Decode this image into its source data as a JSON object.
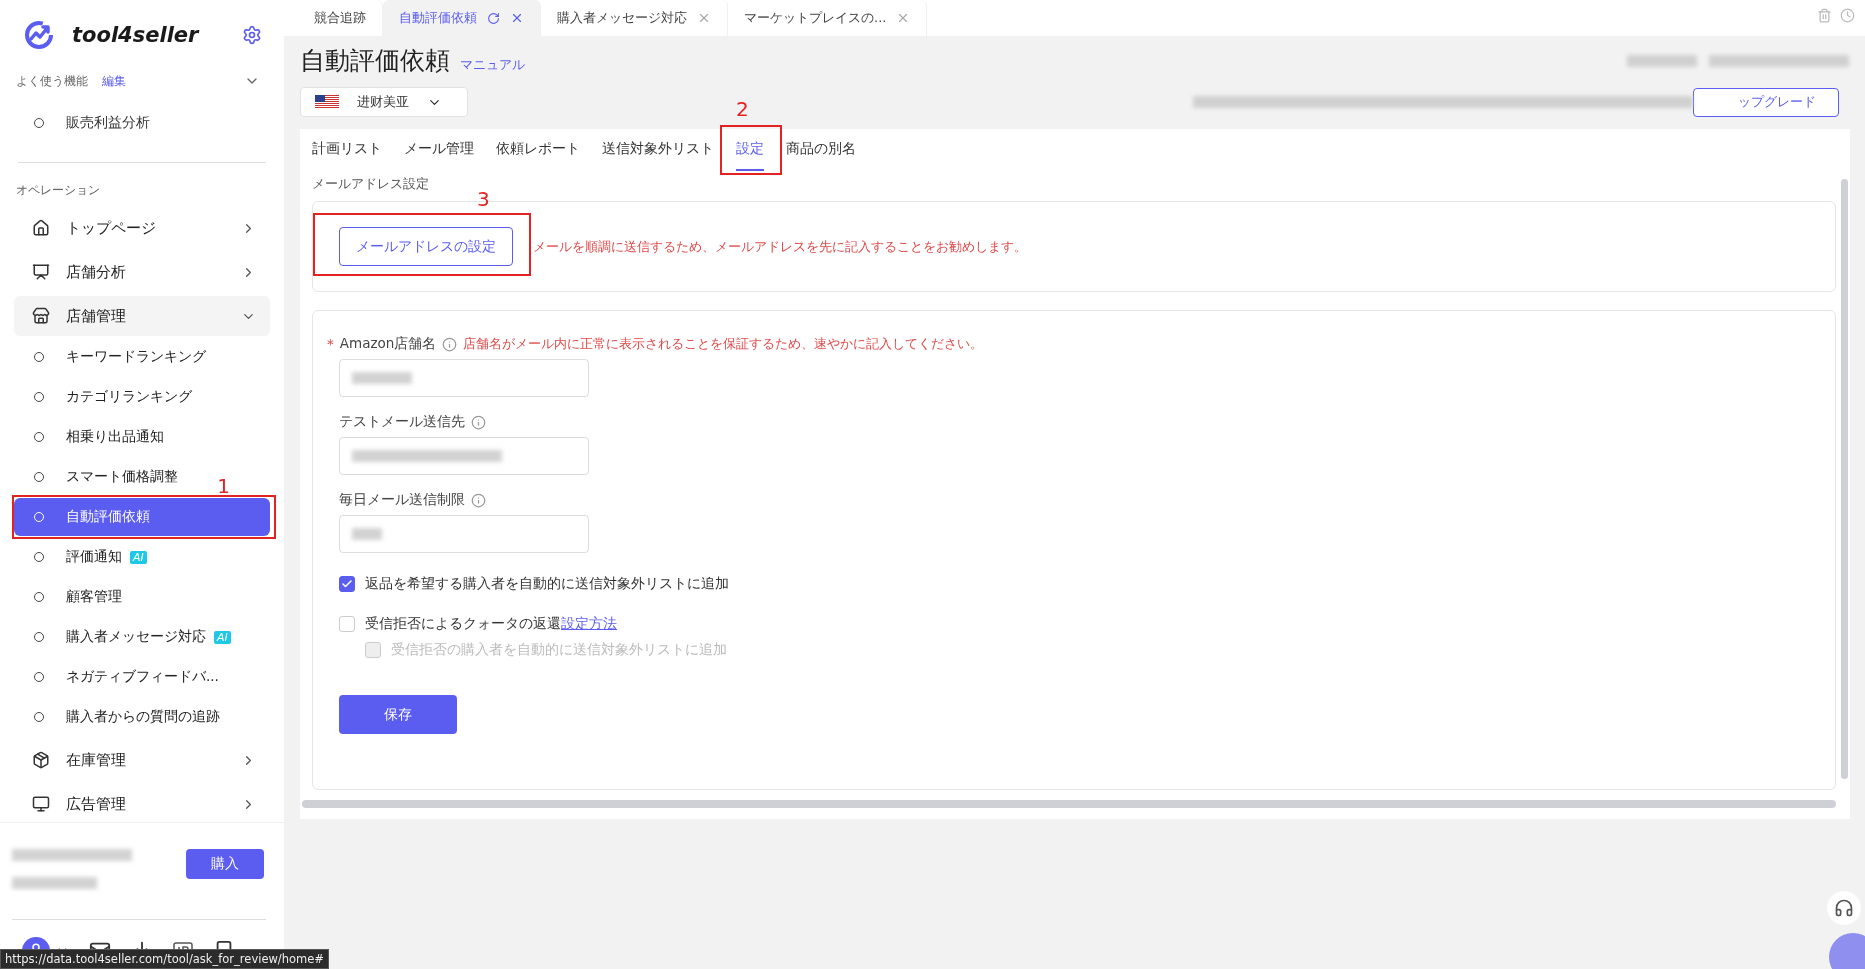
{
  "sidebar": {
    "brand": "tool4seller",
    "favorites": {
      "title": "よく使う機能",
      "edit": "編集",
      "expanded": true,
      "items": [
        {
          "label": "販売利益分析"
        }
      ]
    },
    "section_title": "オペレーション",
    "groups": [
      {
        "label": "トップページ",
        "expanded": false
      },
      {
        "label": "店舗分析",
        "expanded": false
      },
      {
        "label": "店舗管理",
        "expanded": true,
        "children": [
          {
            "label": "キーワードランキング",
            "selected": false
          },
          {
            "label": "カテゴリランキング",
            "selected": false
          },
          {
            "label": "相乗り出品通知",
            "selected": false
          },
          {
            "label": "スマート価格調整",
            "selected": false
          },
          {
            "label": "自動評価依頼",
            "selected": true,
            "annotation": "1"
          },
          {
            "label": "評価通知",
            "selected": false,
            "badge": "AI"
          },
          {
            "label": "顧客管理",
            "selected": false
          },
          {
            "label": "購入者メッセージ対応",
            "selected": false,
            "badge": "AI"
          },
          {
            "label": "ネガティブフィードバ...",
            "selected": false
          },
          {
            "label": "購入者からの質問の追跡",
            "selected": false
          }
        ]
      },
      {
        "label": "在庫管理",
        "expanded": false
      },
      {
        "label": "広告管理",
        "expanded": false
      }
    ],
    "purchase_button": "購入"
  },
  "url_hint": "https://data.tool4seller.com/tool/ask_for_review/home#",
  "tabs": [
    {
      "label": "競合追跡",
      "selected": false,
      "closable": false
    },
    {
      "label": "自動評価依頼",
      "selected": true,
      "closable": true
    },
    {
      "label": "購入者メッセージ対応",
      "selected": false,
      "closable": true
    },
    {
      "label": "マーケットプレイスの...",
      "selected": false,
      "closable": true
    }
  ],
  "page": {
    "title": "自動評価依頼",
    "manual_link": "マニュアル",
    "store": "进财美亚",
    "upgrade_button": "ップグレード"
  },
  "sub_tabs": [
    {
      "label": "計画リスト",
      "selected": false
    },
    {
      "label": "メール管理",
      "selected": false
    },
    {
      "label": "依頼レポート",
      "selected": false
    },
    {
      "label": "送信対象外リスト",
      "selected": false
    },
    {
      "label": "設定",
      "selected": true,
      "annotation": "2"
    },
    {
      "label": "商品の別名",
      "selected": false
    }
  ],
  "email_section": {
    "title": "メールアドレス設定",
    "button": "メールアドレスの設定",
    "annotation": "3",
    "notice": "メールを順調に送信するため、メールアドレスを先に記入することをお勧めします。"
  },
  "form": {
    "fields": [
      {
        "label": "Amazon店舗名",
        "required_mark": "*",
        "hint": "店舗名がメール内に正常に表示されることを保証するため、速やかに記入してください。"
      },
      {
        "label": "テストメール送信先"
      },
      {
        "label": "毎日メール送信制限"
      }
    ],
    "options": [
      {
        "label": "返品を希望する購入者を自動的に送信対象外リストに追加",
        "checked": true,
        "disabled": false
      },
      {
        "label": "受信拒否によるクォータの返還",
        "link": "設定方法",
        "checked": false,
        "disabled": false,
        "children": [
          {
            "label": "受信拒否の購入者を自動的に送信対象外リストに追加",
            "checked": false,
            "disabled": true
          }
        ]
      }
    ],
    "save_button": "保存"
  }
}
